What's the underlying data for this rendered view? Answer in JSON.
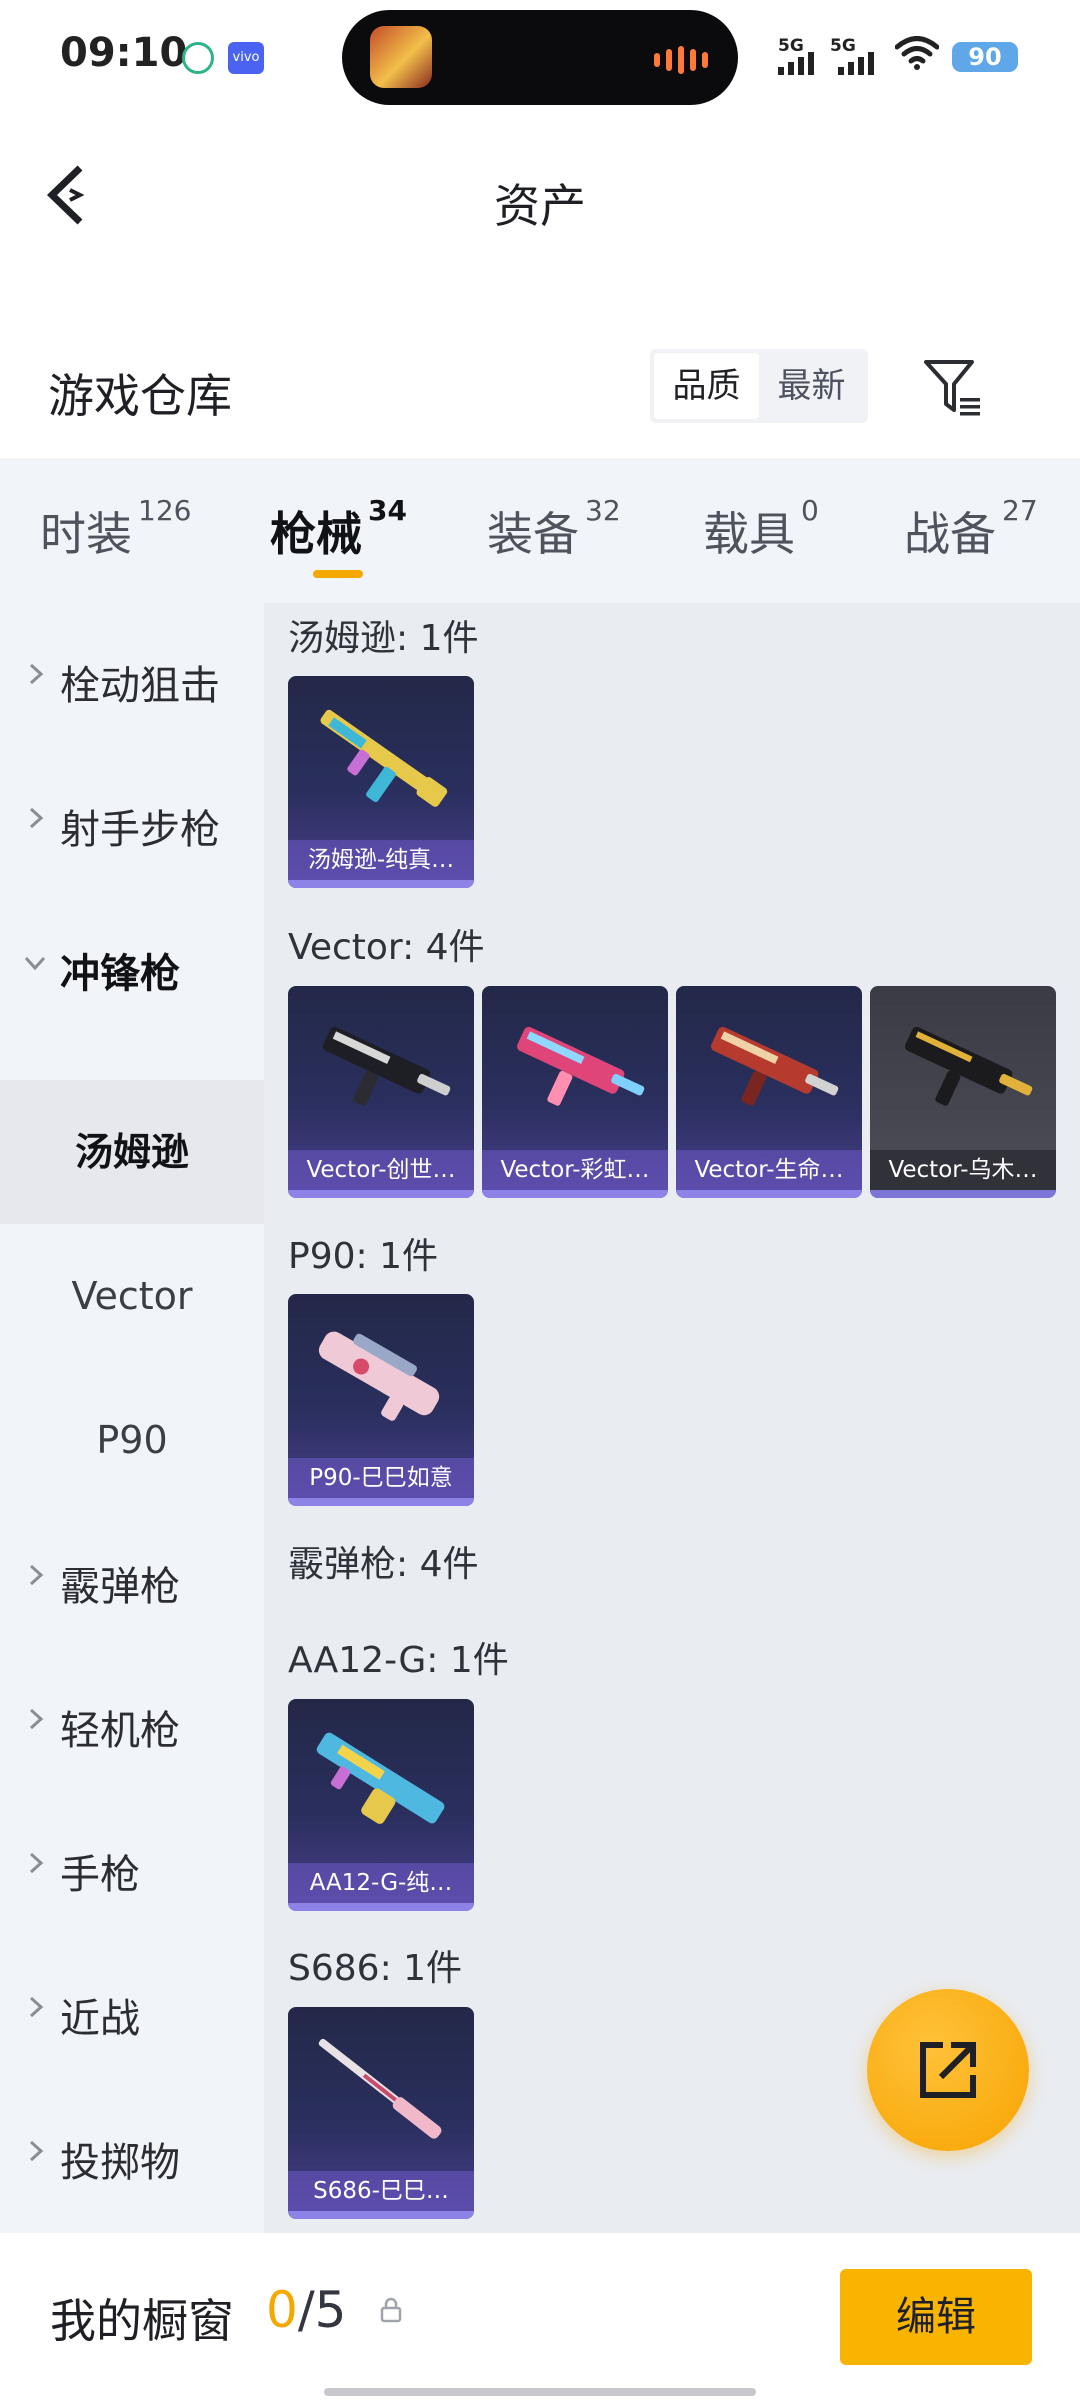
{
  "status_bar": {
    "time": "09:10",
    "badge_b": "vivo",
    "net1": "5G",
    "net2": "5G",
    "battery": "90"
  },
  "header": {
    "title": "资产"
  },
  "warehouse": {
    "title": "游戏仓库",
    "sort_options": [
      "品质",
      "最新"
    ]
  },
  "tabs": [
    {
      "label": "时装",
      "count": "126"
    },
    {
      "label": "枪械",
      "count": "34"
    },
    {
      "label": "装备",
      "count": "32"
    },
    {
      "label": "载具",
      "count": "0"
    },
    {
      "label": "战备",
      "count": "27"
    }
  ],
  "sidenav": {
    "items": [
      "栓动狙击",
      "射手步枪",
      "冲锋枪",
      "汤姆逊",
      "Vector",
      "P90",
      "霰弹枪",
      "轻机枪",
      "手枪",
      "近战",
      "投掷物"
    ]
  },
  "groups": [
    {
      "title": "汤姆逊: 1件",
      "items": [
        "汤姆逊-纯真…"
      ]
    },
    {
      "title": "Vector: 4件",
      "items": [
        "Vector-创世…",
        "Vector-彩虹…",
        "Vector-生命…",
        "Vector-乌木…"
      ]
    },
    {
      "title": "P90: 1件",
      "items": [
        "P90-巳巳如意"
      ]
    },
    {
      "title": "霰弹枪: 4件",
      "items": []
    },
    {
      "title": "AA12-G: 1件",
      "items": [
        "AA12-G-纯…"
      ]
    },
    {
      "title": "S686: 1件",
      "items": [
        "S686-巳巳…"
      ]
    }
  ],
  "bottom_bar": {
    "title": "我的橱窗",
    "current": "0",
    "total": "/5",
    "edit_label": "编辑"
  },
  "colors": {
    "accent": "#f9b400",
    "nav_bg": "#f1f4f8",
    "content_bg": "#e9ecf1"
  }
}
